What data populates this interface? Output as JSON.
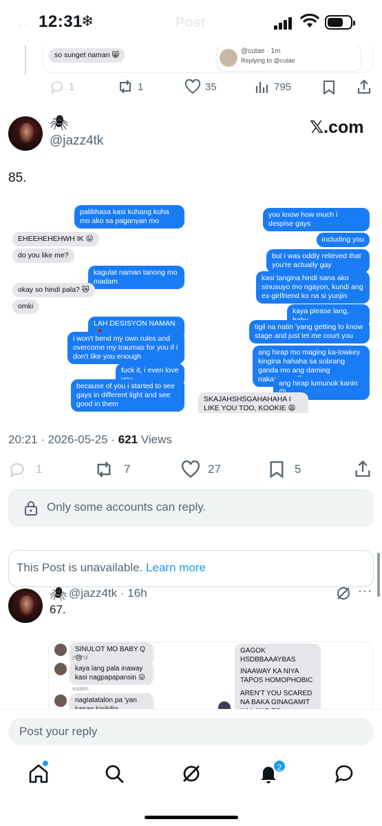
{
  "status_bar": {
    "time": "12:31",
    "weather_glyph": "❄"
  },
  "header": {
    "title": "Post"
  },
  "quoted_top": {
    "bubble_left": "so sunget naman 😸",
    "reply_handle": "@cutae · 1m",
    "replying_to": "Replying to @cutae"
  },
  "top_actions": {
    "replies": "1",
    "reposts": "1",
    "likes": "35",
    "views": "795"
  },
  "tweet": {
    "spider": "🕷",
    "handle": "@jazz4tk",
    "brand": "𝕏.com",
    "text": "85.",
    "timestamp": "20:21 · 2026-05-25 · ",
    "views_count": "621",
    "views_label": " Views",
    "actions": {
      "replies": "1",
      "reposts": "7",
      "likes": "27",
      "bookmarks": "5"
    }
  },
  "chat_left": [
    {
      "side": "blue",
      "text": "palibhasa kasi kuhang kuha mo ako sa paganyan mo"
    },
    {
      "side": "gray",
      "text": "EHEEHEHEHWH IK 😛"
    },
    {
      "side": "gray",
      "text": "do you like me?"
    },
    {
      "side": "blue",
      "text": "kagulat naman tanong mo madam"
    },
    {
      "side": "gray",
      "text": "okay so hindi pala? 😿"
    },
    {
      "side": "gray",
      "text": "omki"
    },
    {
      "side": "blue",
      "text": "LAH DESISYON NAMAN 🥀"
    },
    {
      "side": "blue",
      "text": "i won't bend my own rules and overcome my traumas for you if i don't like you enough"
    },
    {
      "side": "blue",
      "text": "fuck it, i even love you"
    },
    {
      "side": "blue",
      "text": "because of you i started to see gays in different light and see good in them"
    }
  ],
  "chat_right": [
    {
      "side": "blue",
      "text": "you know how much i despise gays"
    },
    {
      "side": "blue",
      "text": "including you"
    },
    {
      "side": "blue",
      "text": "but i was oddly relieved that you're actually gay"
    },
    {
      "side": "blue",
      "text": "kasi tangina hindi sana ako sinusuyo mo ngayon, kundi ang ex-girlfriend ko na si yunjin"
    },
    {
      "side": "blue",
      "text": "kaya please lang, baby"
    },
    {
      "side": "blue",
      "text": "tigil na natin 'yang getting to know stage and just let me court you"
    },
    {
      "side": "blue",
      "text": "ang hirap mo maging ka-lowkey kingina hahaha sa sobrang ganda mo ang daming nakaabang 😛"
    },
    {
      "side": "blue",
      "text": "ang hirap lumunok kanin 😔"
    },
    {
      "side": "gray",
      "text": "SKAJAHSHSGAHAHAHA I LIKE YOU TOO, KOOKIE 😩💘"
    }
  ],
  "reply_restriction": "Only some accounts can reply.",
  "unavailable": {
    "text": "This Post is unavailable. ",
    "link": "Learn more"
  },
  "reply_tweet": {
    "spider": "🕷",
    "handle": "@jazz4tk",
    "time": " · 16h",
    "more": "···",
    "text": "67."
  },
  "sub_chat": {
    "left": [
      {
        "label": "",
        "text": "SINULOT MO BABY Q 😞"
      },
      {
        "label": "yoongi",
        "text": "kaya lang pala inaway kasi nagpapapansin 😛"
      },
      {
        "label": "soobin",
        "text": "nagtatatalon pa 'yan kapag kinikilig"
      }
    ],
    "right": [
      {
        "text": "GAGOK HSDBBAAAYBAS BAKIT SYA"
      },
      {
        "text": "INAAWAY KA NIYA TAPOS HOMOPHOBIC PA"
      },
      {
        "text": "AREN'T YOU SCARED NA BAKA GINAGAMIT KA LANG TO EXPLORE? 😬"
      }
    ]
  },
  "compose": {
    "placeholder": "Post your reply"
  },
  "tabbar": {
    "notifications_badge": "2"
  },
  "colors": {
    "accent": "#1d9bf0",
    "imessage_blue": "#1a7cf5",
    "gray_bubble": "#e5e5ea",
    "muted": "#536471"
  }
}
